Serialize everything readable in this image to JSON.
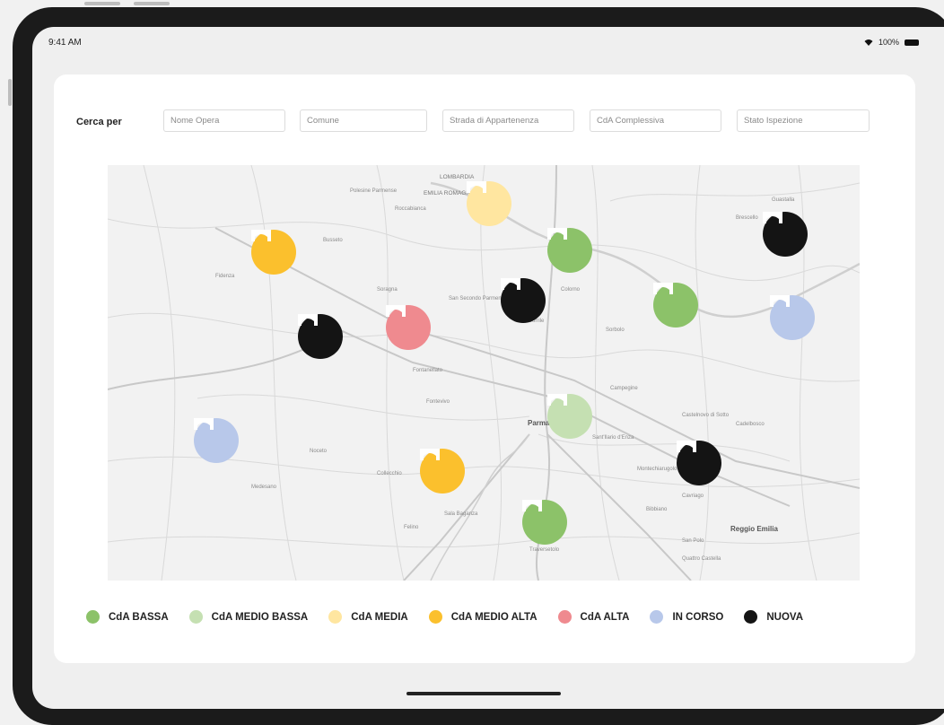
{
  "status_bar": {
    "time": "9:41 AM",
    "battery": "100%"
  },
  "search": {
    "label": "Cerca per",
    "fields": [
      {
        "placeholder": "Nome Opera"
      },
      {
        "placeholder": "Comune"
      },
      {
        "placeholder": "Strada di Appartenenza"
      },
      {
        "placeholder": "CdA Complessiva"
      },
      {
        "placeholder": "Stato Ispezione"
      }
    ]
  },
  "colors": {
    "cda_bassa": "#8cc269",
    "cda_medio_bassa": "#c5e0b2",
    "cda_media": "#ffe6a0",
    "cda_medio_alta": "#fbc02d",
    "cda_alta": "#ef8a8f",
    "in_corso": "#b8c8ea",
    "nuova": "#141414"
  },
  "map": {
    "labels": [
      "LOMBARDIA",
      "EMILIA ROMAGNA",
      "Parma",
      "Reggio Emilia",
      "Fidenza",
      "Busseto",
      "Colorno",
      "Torrile",
      "Sorbolo",
      "Montechiarugolo",
      "Noceto",
      "Medesano",
      "Collecchio",
      "Felino",
      "Sala Baganza",
      "Traversetolo",
      "San Polo",
      "Brescello",
      "Guastalla",
      "Cadelbosco",
      "Castelnovo di Sotto",
      "Campegine",
      "Sant'Ilario d'Enza",
      "Fontanellato",
      "Soragna",
      "Roccabianca",
      "Polesine Parmense",
      "San Secondo Parmense",
      "Fontevivo",
      "Cavriago",
      "Bibbiano",
      "Quattro Castella"
    ],
    "markers": [
      {
        "status": "cda_media",
        "icon": "bridge-icon"
      },
      {
        "status": "nuova",
        "icon": "bridge-icon"
      },
      {
        "status": "cda_medio_alta",
        "icon": "bridge-icon"
      },
      {
        "status": "cda_bassa",
        "icon": "bridge-icon"
      },
      {
        "status": "nuova",
        "icon": "bridge-icon"
      },
      {
        "status": "cda_bassa",
        "icon": "bridge-icon"
      },
      {
        "status": "in_corso",
        "icon": "bridge-icon"
      },
      {
        "status": "cda_alta",
        "icon": "bridge-icon"
      },
      {
        "status": "nuova",
        "icon": "bridge-icon"
      },
      {
        "status": "cda_medio_bassa",
        "icon": "bridge-icon"
      },
      {
        "status": "in_corso",
        "icon": "bridge-icon"
      },
      {
        "status": "cda_medio_alta",
        "icon": "bridge-icon"
      },
      {
        "status": "nuova",
        "icon": "bridge-icon"
      },
      {
        "status": "cda_bassa",
        "icon": "bridge-icon"
      }
    ]
  },
  "legend": [
    {
      "label": "CdA BASSA",
      "color": "#8cc269"
    },
    {
      "label": "CdA MEDIO BASSA",
      "color": "#c5e0b2"
    },
    {
      "label": "CdA MEDIA",
      "color": "#ffe6a0"
    },
    {
      "label": "CdA MEDIO ALTA",
      "color": "#fbc02d"
    },
    {
      "label": "CdA ALTA",
      "color": "#ef8a8f"
    },
    {
      "label": "IN CORSO",
      "color": "#b8c8ea"
    },
    {
      "label": "NUOVA",
      "color": "#141414"
    }
  ]
}
